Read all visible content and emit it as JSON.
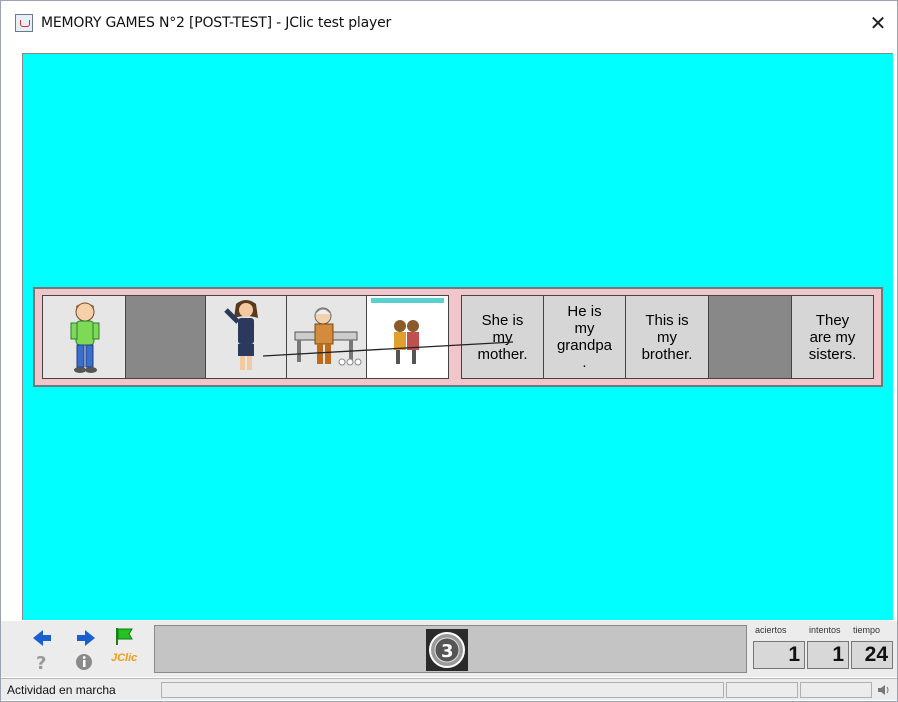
{
  "window": {
    "title": "MEMORY GAMES N°2 [POST-TEST] - JClic test player",
    "close_glyph": "✕",
    "app_icon": "java-cup-icon"
  },
  "board": {
    "left_panel": [
      {
        "kind": "image",
        "icon": "boy-figure-icon",
        "state": "revealed"
      },
      {
        "kind": "hidden",
        "state": "covered"
      },
      {
        "kind": "image",
        "icon": "woman-figure-icon",
        "state": "revealed"
      },
      {
        "kind": "image",
        "icon": "grandpa-figure-icon",
        "state": "revealed"
      },
      {
        "kind": "image",
        "icon": "sisters-figure-icon",
        "state": "selected"
      }
    ],
    "right_panel": [
      {
        "kind": "text",
        "text": "She is\nmy\nmother."
      },
      {
        "kind": "text",
        "text": "He is\nmy\ngrandpa\n."
      },
      {
        "kind": "text",
        "text": "This is\nmy\nbrother."
      },
      {
        "kind": "hidden",
        "text": ""
      },
      {
        "kind": "text",
        "text": "They\nare my\nsisters."
      }
    ]
  },
  "controls": {
    "prev_icon": "arrow-left-icon",
    "next_icon": "arrow-right-icon",
    "reset_icon": "flag-icon",
    "help_icon": "question-icon",
    "info_icon": "info-icon",
    "logo_text": "JClic",
    "activity_counter": "3"
  },
  "counters": {
    "aciertos_label": "aciertos",
    "intentos_label": "intentos",
    "tiempo_label": "tiempo",
    "aciertos": "1",
    "intentos": "1",
    "tiempo": "24"
  },
  "status": {
    "text": "Actividad en marcha",
    "sound_icon": "speaker-icon"
  },
  "colors": {
    "stage_bg": "#00ffff",
    "board_bg": "#f1c6cb",
    "hidden_cell": "#888888",
    "text_cell": "#d6d6d6",
    "arrow_blue": "#1a5fd0",
    "flag_green": "#22c322"
  }
}
